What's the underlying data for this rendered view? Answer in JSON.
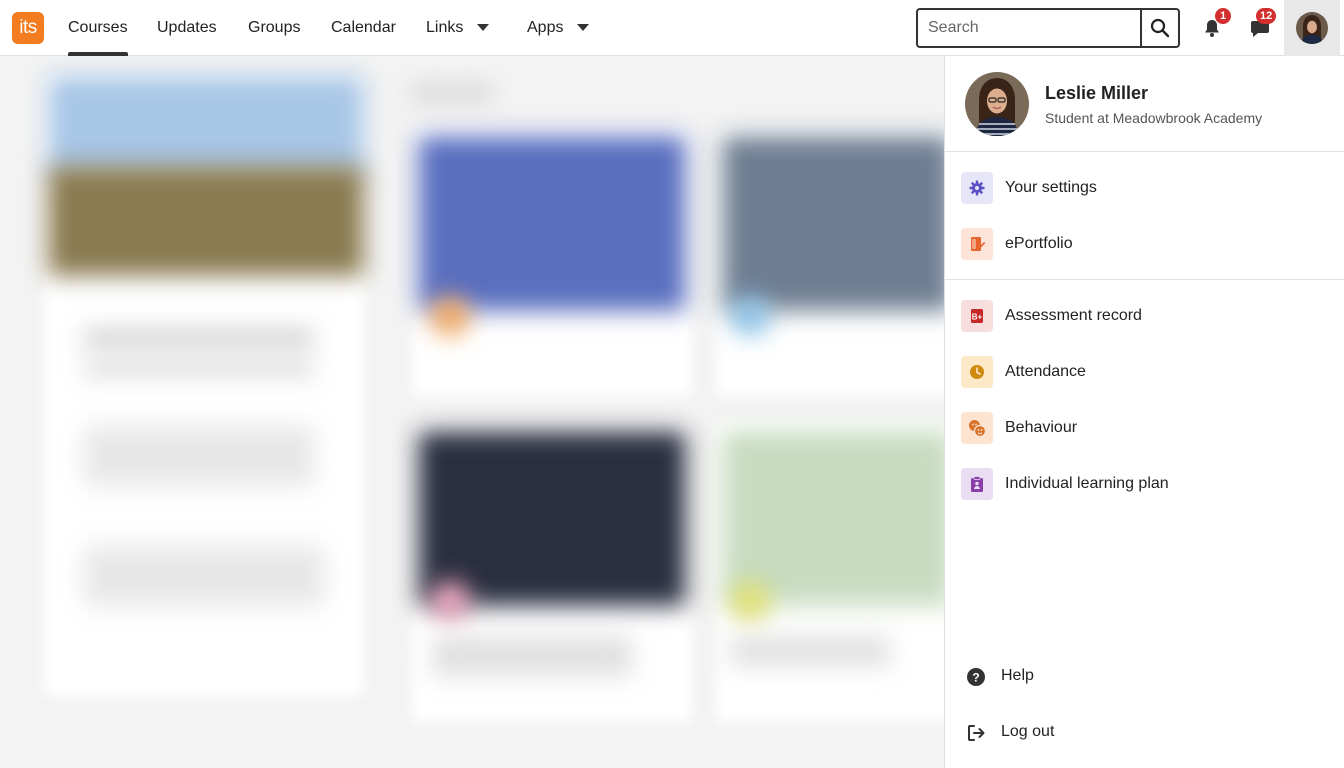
{
  "app": {
    "logo_text": "its",
    "brand_color": "#f47c20"
  },
  "nav": {
    "items": [
      {
        "label": "Courses",
        "active": true
      },
      {
        "label": "Updates"
      },
      {
        "label": "Groups"
      },
      {
        "label": "Calendar"
      },
      {
        "label": "Links",
        "dropdown": true
      },
      {
        "label": "Apps",
        "dropdown": true
      }
    ]
  },
  "search": {
    "placeholder": "Search",
    "value": ""
  },
  "notifications": {
    "count": "1"
  },
  "messages": {
    "count": "12"
  },
  "profile": {
    "name": "Leslie Miller",
    "role": "Student at Meadowbrook Academy"
  },
  "menu": {
    "group1": [
      {
        "label": "Your settings",
        "icon": "gear-icon"
      },
      {
        "label": "ePortfolio",
        "icon": "portfolio-icon"
      }
    ],
    "group2": [
      {
        "label": "Assessment record",
        "icon": "assessment-icon"
      },
      {
        "label": "Attendance",
        "icon": "clock-icon"
      },
      {
        "label": "Behaviour",
        "icon": "behaviour-icon"
      },
      {
        "label": "Individual learning plan",
        "icon": "clipboard-icon"
      }
    ],
    "footer": [
      {
        "label": "Help",
        "icon": "help-icon"
      },
      {
        "label": "Log out",
        "icon": "logout-icon"
      }
    ]
  }
}
